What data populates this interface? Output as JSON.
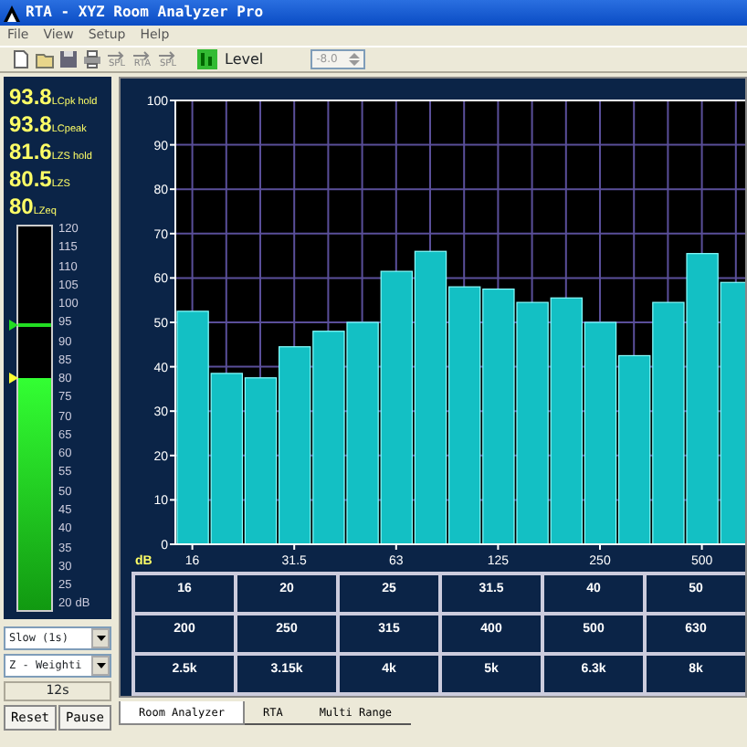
{
  "window": {
    "title": "RTA - XYZ Room Analyzer Pro"
  },
  "menu": [
    "File",
    "View",
    "Setup",
    "Help"
  ],
  "toolbar": {
    "arrow_buttons": [
      "SPL",
      "RTA",
      "SPL"
    ],
    "level_label": "Level",
    "level_field": {
      "value": "-8.0",
      "disabled": true
    }
  },
  "readings": [
    {
      "value": "93.8",
      "label": "LCpk hold"
    },
    {
      "value": "93.8",
      "label": "LCpeak"
    },
    {
      "value": "81.6",
      "label": "LZS hold"
    },
    {
      "value": "80.5",
      "label": "LZS"
    },
    {
      "value": "80",
      "label": "LZeq"
    }
  ],
  "meter": {
    "level": 0.605,
    "peak": {
      "level": 0.738
    },
    "scale": [
      "120",
      "115",
      "110",
      "105",
      "100",
      "95",
      "90",
      "85",
      "80",
      "75",
      "70",
      "65",
      "60",
      "55",
      "50",
      "45",
      "40",
      "35",
      "30",
      "25",
      "20"
    ],
    "unit": "dB"
  },
  "response": {
    "value": "Slow (1s)"
  },
  "weighting": {
    "value": "Z - Weighti"
  },
  "elapsed": "12s",
  "buttons": [
    "Reset",
    "Pause"
  ],
  "rta": {
    "chart_data": {
      "type": "bar",
      "ylabel": "dB",
      "values": [
        52.5,
        38.5,
        37.5,
        44.5,
        48,
        50,
        61.5,
        66,
        58,
        57.5,
        54.5,
        55.5,
        50,
        42.5,
        54.5,
        65.5,
        59
      ],
      "ylim": [
        0,
        100
      ],
      "yticks": [
        0,
        10,
        20,
        30,
        40,
        50,
        60,
        70,
        80,
        90,
        100
      ],
      "grid": true
    },
    "band_labels": [
      "16",
      "31.5",
      "63",
      "125",
      "250",
      "500"
    ]
  },
  "bands": [
    [
      "16",
      "20",
      "25",
      "31.5",
      "40",
      "50"
    ],
    [
      "200",
      "250",
      "315",
      "400",
      "500",
      "630"
    ],
    [
      "2.5k",
      "3.15k",
      "4k",
      "5k",
      "6.3k",
      "8k"
    ]
  ],
  "tabs": [
    {
      "label": "Room Analyzer",
      "selected": true
    },
    {
      "label": "RTA",
      "selected": false
    },
    {
      "label": "Multi Range",
      "selected": false
    }
  ]
}
